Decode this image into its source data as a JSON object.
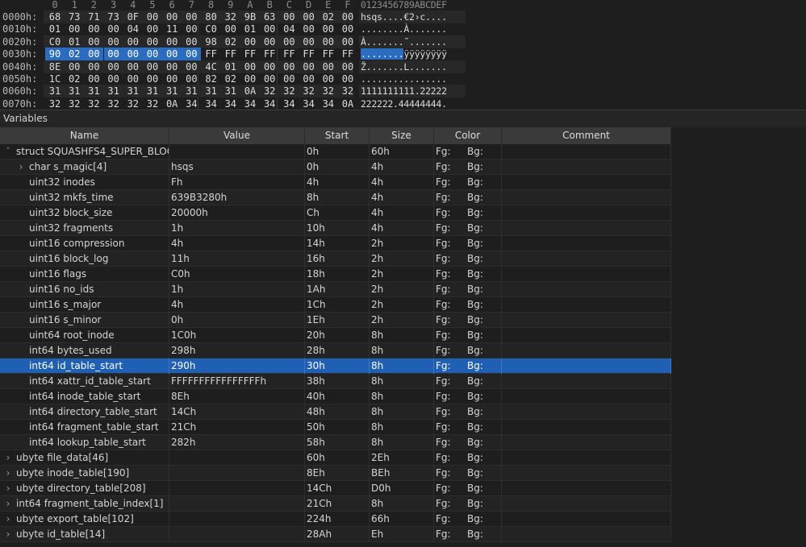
{
  "hex": {
    "header_cols": [
      "0",
      "1",
      "2",
      "3",
      "4",
      "5",
      "6",
      "7",
      "8",
      "9",
      "A",
      "B",
      "C",
      "D",
      "E",
      "F"
    ],
    "ascii_header": "0123456789ABCDEF",
    "rows": [
      {
        "addr": "0000h:",
        "bytes": [
          "68",
          "73",
          "71",
          "73",
          "0F",
          "00",
          "00",
          "00",
          "80",
          "32",
          "9B",
          "63",
          "00",
          "00",
          "02",
          "00"
        ],
        "ascii": "hsqs....€2›c...."
      },
      {
        "addr": "0010h:",
        "bytes": [
          "01",
          "00",
          "00",
          "00",
          "04",
          "00",
          "11",
          "00",
          "C0",
          "00",
          "01",
          "00",
          "04",
          "00",
          "00",
          "00"
        ],
        "ascii": "........À......."
      },
      {
        "addr": "0020h:",
        "bytes": [
          "C0",
          "01",
          "00",
          "00",
          "00",
          "00",
          "00",
          "00",
          "98",
          "02",
          "00",
          "00",
          "00",
          "00",
          "00",
          "00"
        ],
        "ascii": "À.......˜......."
      },
      {
        "addr": "0030h:",
        "bytes": [
          "90",
          "02",
          "00",
          "00",
          "00",
          "00",
          "00",
          "00",
          "FF",
          "FF",
          "FF",
          "FF",
          "FF",
          "FF",
          "FF",
          "FF"
        ],
        "ascii_sel": "........",
        "ascii_rest": "ÿÿÿÿÿÿÿÿ"
      },
      {
        "addr": "0040h:",
        "bytes": [
          "8E",
          "00",
          "00",
          "00",
          "00",
          "00",
          "00",
          "00",
          "4C",
          "01",
          "00",
          "00",
          "00",
          "00",
          "00",
          "00"
        ],
        "ascii": "Ž.......L......."
      },
      {
        "addr": "0050h:",
        "bytes": [
          "1C",
          "02",
          "00",
          "00",
          "00",
          "00",
          "00",
          "00",
          "82",
          "02",
          "00",
          "00",
          "00",
          "00",
          "00",
          "00"
        ],
        "ascii": "................"
      },
      {
        "addr": "0060h:",
        "bytes": [
          "31",
          "31",
          "31",
          "31",
          "31",
          "31",
          "31",
          "31",
          "31",
          "31",
          "0A",
          "32",
          "32",
          "32",
          "32",
          "32"
        ],
        "ascii": "1111111111.22222"
      },
      {
        "addr": "0070h:",
        "bytes": [
          "32",
          "32",
          "32",
          "32",
          "32",
          "32",
          "0A",
          "34",
          "34",
          "34",
          "34",
          "34",
          "34",
          "34",
          "34",
          "0A"
        ],
        "ascii": "222222.44444444."
      }
    ]
  },
  "variables_title": "Variables",
  "columns": [
    "Name",
    "Value",
    "Start",
    "Size",
    "Color",
    "Comment"
  ],
  "rows": [
    {
      "twist": "open",
      "indent": 0,
      "name": "struct SQUASHFS4_SUPER_BLOC...",
      "value": "",
      "start": "0h",
      "size": "60h",
      "fg": "Fg:",
      "bg": "Bg:"
    },
    {
      "twist": "closed",
      "indent": 1,
      "name": "char s_magic[4]",
      "value": "hsqs",
      "start": "0h",
      "size": "4h",
      "fg": "Fg:",
      "bg": "Bg:"
    },
    {
      "twist": "none",
      "indent": 1,
      "name": "uint32 inodes",
      "value": "Fh",
      "start": "4h",
      "size": "4h",
      "fg": "Fg:",
      "bg": "Bg:"
    },
    {
      "twist": "none",
      "indent": 1,
      "name": "uint32 mkfs_time",
      "value": "639B3280h",
      "start": "8h",
      "size": "4h",
      "fg": "Fg:",
      "bg": "Bg:"
    },
    {
      "twist": "none",
      "indent": 1,
      "name": "uint32 block_size",
      "value": "20000h",
      "start": "Ch",
      "size": "4h",
      "fg": "Fg:",
      "bg": "Bg:"
    },
    {
      "twist": "none",
      "indent": 1,
      "name": "uint32 fragments",
      "value": "1h",
      "start": "10h",
      "size": "4h",
      "fg": "Fg:",
      "bg": "Bg:"
    },
    {
      "twist": "none",
      "indent": 1,
      "name": "uint16 compression",
      "value": "4h",
      "start": "14h",
      "size": "2h",
      "fg": "Fg:",
      "bg": "Bg:"
    },
    {
      "twist": "none",
      "indent": 1,
      "name": "uint16 block_log",
      "value": "11h",
      "start": "16h",
      "size": "2h",
      "fg": "Fg:",
      "bg": "Bg:"
    },
    {
      "twist": "none",
      "indent": 1,
      "name": "uint16 flags",
      "value": "C0h",
      "start": "18h",
      "size": "2h",
      "fg": "Fg:",
      "bg": "Bg:"
    },
    {
      "twist": "none",
      "indent": 1,
      "name": "uint16 no_ids",
      "value": "1h",
      "start": "1Ah",
      "size": "2h",
      "fg": "Fg:",
      "bg": "Bg:"
    },
    {
      "twist": "none",
      "indent": 1,
      "name": "uint16 s_major",
      "value": "4h",
      "start": "1Ch",
      "size": "2h",
      "fg": "Fg:",
      "bg": "Bg:"
    },
    {
      "twist": "none",
      "indent": 1,
      "name": "uint16 s_minor",
      "value": "0h",
      "start": "1Eh",
      "size": "2h",
      "fg": "Fg:",
      "bg": "Bg:"
    },
    {
      "twist": "none",
      "indent": 1,
      "name": "uint64 root_inode",
      "value": "1C0h",
      "start": "20h",
      "size": "8h",
      "fg": "Fg:",
      "bg": "Bg:"
    },
    {
      "twist": "none",
      "indent": 1,
      "name": "int64 bytes_used",
      "value": "298h",
      "start": "28h",
      "size": "8h",
      "fg": "Fg:",
      "bg": "Bg:"
    },
    {
      "twist": "none",
      "indent": 1,
      "name": "int64 id_table_start",
      "value": "290h",
      "start": "30h",
      "size": "8h",
      "fg": "Fg:",
      "bg": "Bg:",
      "selected": true
    },
    {
      "twist": "none",
      "indent": 1,
      "name": "int64 xattr_id_table_start",
      "value": "FFFFFFFFFFFFFFFFh",
      "start": "38h",
      "size": "8h",
      "fg": "Fg:",
      "bg": "Bg:"
    },
    {
      "twist": "none",
      "indent": 1,
      "name": "int64 inode_table_start",
      "value": "8Eh",
      "start": "40h",
      "size": "8h",
      "fg": "Fg:",
      "bg": "Bg:"
    },
    {
      "twist": "none",
      "indent": 1,
      "name": "int64 directory_table_start",
      "value": "14Ch",
      "start": "48h",
      "size": "8h",
      "fg": "Fg:",
      "bg": "Bg:"
    },
    {
      "twist": "none",
      "indent": 1,
      "name": "int64 fragment_table_start",
      "value": "21Ch",
      "start": "50h",
      "size": "8h",
      "fg": "Fg:",
      "bg": "Bg:"
    },
    {
      "twist": "none",
      "indent": 1,
      "name": "int64 lookup_table_start",
      "value": "282h",
      "start": "58h",
      "size": "8h",
      "fg": "Fg:",
      "bg": "Bg:"
    },
    {
      "twist": "closed",
      "indent": 0,
      "name": "ubyte file_data[46]",
      "value": "",
      "start": "60h",
      "size": "2Eh",
      "fg": "Fg:",
      "bg": "Bg:"
    },
    {
      "twist": "closed",
      "indent": 0,
      "name": "ubyte inode_table[190]",
      "value": "",
      "start": "8Eh",
      "size": "BEh",
      "fg": "Fg:",
      "bg": "Bg:"
    },
    {
      "twist": "closed",
      "indent": 0,
      "name": "ubyte directory_table[208]",
      "value": "",
      "start": "14Ch",
      "size": "D0h",
      "fg": "Fg:",
      "bg": "Bg:"
    },
    {
      "twist": "closed",
      "indent": 0,
      "name": "int64 fragment_table_index[1]",
      "value": "",
      "start": "21Ch",
      "size": "8h",
      "fg": "Fg:",
      "bg": "Bg:"
    },
    {
      "twist": "closed",
      "indent": 0,
      "name": "ubyte export_table[102]",
      "value": "",
      "start": "224h",
      "size": "66h",
      "fg": "Fg:",
      "bg": "Bg:"
    },
    {
      "twist": "closed",
      "indent": 0,
      "name": "ubyte id_table[14]",
      "value": "",
      "start": "28Ah",
      "size": "Eh",
      "fg": "Fg:",
      "bg": "Bg:"
    }
  ],
  "colors": {
    "selection": "#1f5fb4",
    "hex_selection": "#2a6cc0"
  }
}
